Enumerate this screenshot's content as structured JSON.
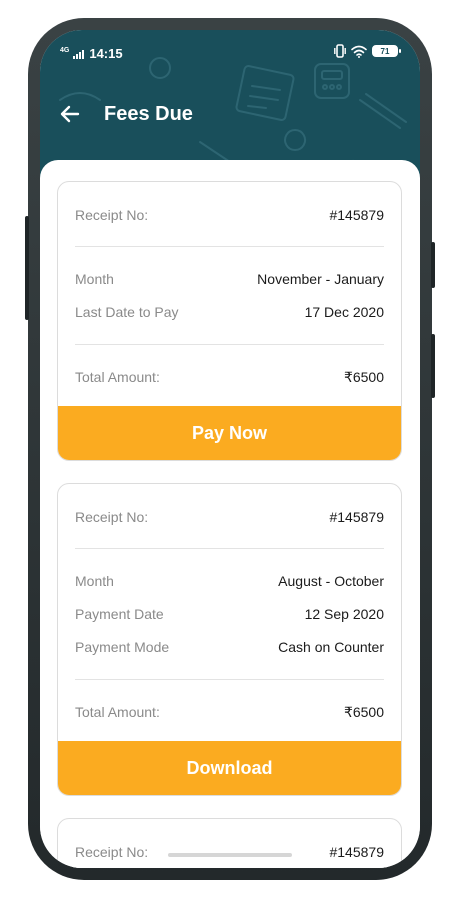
{
  "status_bar": {
    "network": "4G",
    "time": "14:15",
    "battery": "71"
  },
  "header": {
    "title": "Fees Due",
    "back_icon": "arrow-left-icon"
  },
  "colors": {
    "header_bg": "#194f5b",
    "accent": "#fbab20"
  },
  "cards": [
    {
      "receipt_label": "Receipt No:",
      "receipt_value": "#145879",
      "rows": [
        {
          "label": "Month",
          "value": "November - January"
        },
        {
          "label": "Last Date to Pay",
          "value": "17 Dec 2020"
        }
      ],
      "total_label": "Total Amount:",
      "total_value": "₹6500",
      "button": "Pay Now"
    },
    {
      "receipt_label": "Receipt No:",
      "receipt_value": "#145879",
      "rows": [
        {
          "label": "Month",
          "value": "August - October"
        },
        {
          "label": "Payment Date",
          "value": "12 Sep 2020"
        },
        {
          "label": "Payment Mode",
          "value": "Cash on Counter"
        }
      ],
      "total_label": "Total Amount:",
      "total_value": "₹6500",
      "button": "Download"
    },
    {
      "receipt_label": "Receipt No:",
      "receipt_value": "#145879"
    }
  ]
}
